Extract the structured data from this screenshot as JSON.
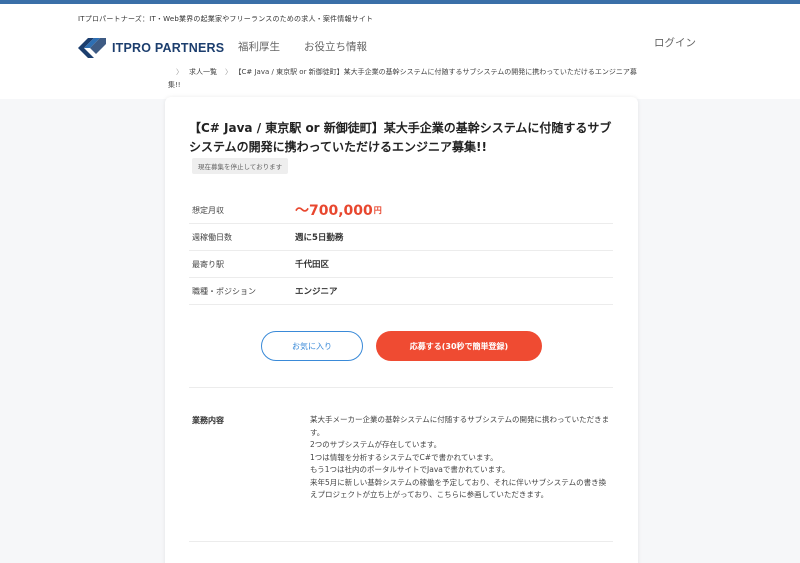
{
  "header": {
    "tagline": "ITプロパートナーズ：IT・Web業界の起業家やフリーランスのための求人・案件情報サイト",
    "logo_text": "ITPRO PARTNERS",
    "nav": [
      "福利厚生",
      "お役立ち情報"
    ],
    "login": "ログイン"
  },
  "breadcrumb": {
    "items": [
      "求人一覧",
      "【C# Java / 東京駅 or 新御徒町】某大手企業の基幹システムに付随するサブシステムの開発に携わっていただけるエンジニア募集!!"
    ]
  },
  "job": {
    "title": "【C# Java / 東京駅 or 新御徒町】某大手企業の基幹システムに付随するサブシステムの開発に携わっていただけるエンジニア募集!!",
    "status": "現在募集を停止しております",
    "salary_label": "想定月収",
    "salary_value": "〜700,000",
    "salary_unit": "円",
    "days_label": "週稼働日数",
    "days_value": "週に5日勤務",
    "station_label": "最寄り駅",
    "station_value": "千代田区",
    "position_label": "職種・ポジション",
    "position_value": "エンジニア",
    "favorite_button": "お気に入り",
    "apply_button": "応募する(30秒で簡単登録)",
    "detail_label": "業務内容",
    "detail_lines": [
      "某大手メーカー企業の基幹システムに付随するサブシステムの開発に携わっていただきます。",
      "2つのサブシステムが存在しています。",
      "1つは情報を分析するシステムでC#で書かれています。",
      "もう1つは社内のポータルサイトでJavaで書かれています。",
      "来年5月に新しい基幹システムの稼働を予定しており、それに伴いサブシステムの書き換えプロジェクトが立ち上がっており、こちらに参画していただきます。"
    ]
  },
  "colors": {
    "accent_red": "#ef4b32",
    "accent_blue": "#3a8ad8",
    "brand_navy": "#1c3e6e",
    "top_bar": "#3a6fa8"
  }
}
